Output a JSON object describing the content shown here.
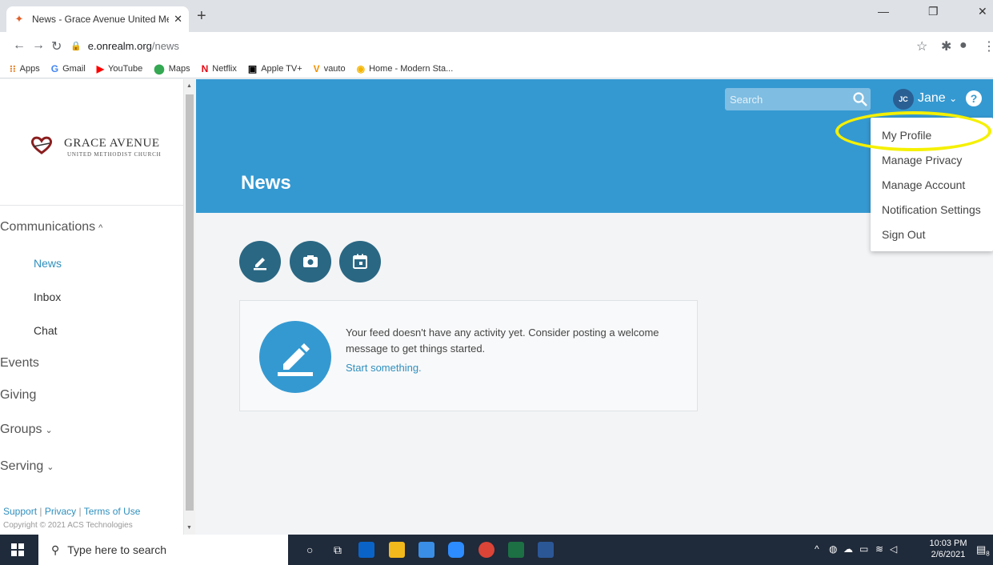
{
  "browser": {
    "tab_title": "News - Grace Avenue United Me",
    "url_host": "e.onrealm.org",
    "url_path": "/news",
    "bookmarks": [
      {
        "label": "Apps",
        "icon": "apps-grid-icon",
        "color": "#e8710a"
      },
      {
        "label": "Gmail",
        "icon": "gmail-icon",
        "color": "#4285f4"
      },
      {
        "label": "YouTube",
        "icon": "youtube-icon",
        "color": "#ff0000"
      },
      {
        "label": "Maps",
        "icon": "maps-icon",
        "color": "#34a853"
      },
      {
        "label": "Netflix",
        "icon": "netflix-icon",
        "color": "#e50914"
      },
      {
        "label": "Apple TV+",
        "icon": "appletv-icon",
        "color": "#000000"
      },
      {
        "label": "vauto",
        "icon": "vauto-icon",
        "color": "#f29100"
      },
      {
        "label": "Home - Modern Sta...",
        "icon": "home-icon",
        "color": "#f4b400"
      }
    ]
  },
  "sidebar": {
    "logo_main": "Grace Avenue",
    "logo_sub": "UNITED METHODIST CHURCH",
    "nav": {
      "communications": "Communications",
      "news": "News",
      "inbox": "Inbox",
      "chat": "Chat",
      "events": "Events",
      "giving": "Giving",
      "groups": "Groups",
      "serving": "Serving"
    },
    "footer": {
      "support": "Support",
      "privacy": "Privacy",
      "terms": "Terms of Use",
      "copyright": "Copyright © 2021 ACS Technologies"
    }
  },
  "header": {
    "title": "News",
    "search_placeholder": "Search",
    "avatar_initials": "JC",
    "user_name": "Jane"
  },
  "user_menu": {
    "items": [
      "My Profile",
      "Manage Privacy",
      "Manage Account",
      "Notification Settings",
      "Sign Out"
    ]
  },
  "feed": {
    "empty_message": "Your feed doesn't have any activity yet. Consider posting a welcome message to get things started.",
    "cta": "Start something."
  },
  "taskbar": {
    "search_placeholder": "Type here to search",
    "time": "10:03 PM",
    "date": "2/6/2021",
    "notification_count": "8"
  },
  "colors": {
    "brand_blue": "#3599d1",
    "action_dark": "#2a6783",
    "highlight": "#f5f000"
  }
}
